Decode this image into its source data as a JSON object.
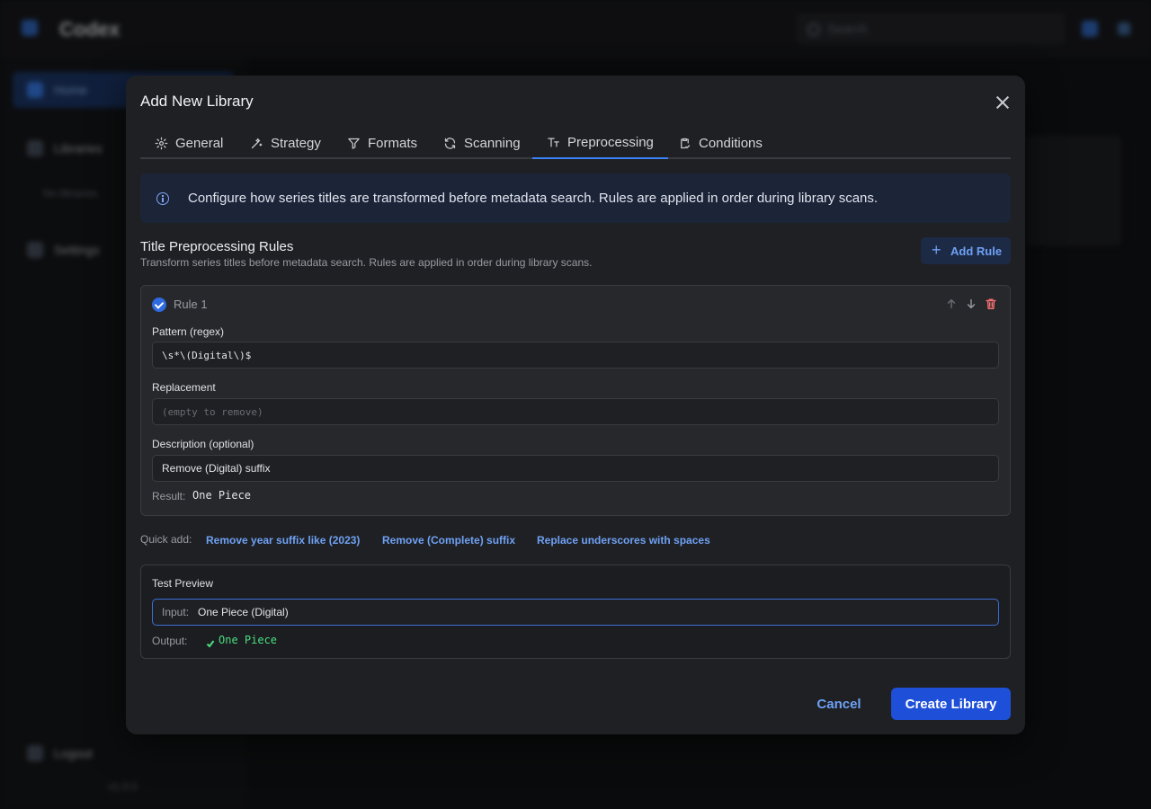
{
  "background": {
    "brand": "Codex",
    "search_placeholder": "Search",
    "nav": [
      "Home",
      "Libraries",
      "Settings",
      "Logout"
    ],
    "sub_text": "No libraries",
    "version": "v1.0.0"
  },
  "modal": {
    "title": "Add New Library",
    "tabs": [
      {
        "label": "General",
        "icon": "gear-icon"
      },
      {
        "label": "Strategy",
        "icon": "wand-icon"
      },
      {
        "label": "Formats",
        "icon": "filter-icon"
      },
      {
        "label": "Scanning",
        "icon": "refresh-icon"
      },
      {
        "label": "Preprocessing",
        "icon": "text-size-icon",
        "active": true
      },
      {
        "label": "Conditions",
        "icon": "clipboard-check-icon"
      }
    ],
    "info": "Configure how series titles are transformed before metadata search. Rules are applied in order during library scans.",
    "section": {
      "title": "Title Preprocessing Rules",
      "description": "Transform series titles before metadata search. Rules are applied in order during library scans.",
      "add_rule": "Add Rule"
    },
    "rule": {
      "label": "Rule 1",
      "pattern_label": "Pattern (regex)",
      "pattern_value": "\\s*\\(Digital\\)$",
      "replacement_label": "Replacement",
      "replacement_value": "",
      "replacement_placeholder": "(empty to remove)",
      "description_label": "Description (optional)",
      "description_value": "Remove (Digital) suffix",
      "result_label": "Result:",
      "result_value": "One Piece"
    },
    "quick_add": {
      "label": "Quick add:",
      "links": [
        "Remove year suffix like (2023)",
        "Remove (Complete) suffix",
        "Replace underscores with spaces"
      ]
    },
    "test": {
      "title": "Test Preview",
      "input_label": "Input:",
      "input_value": "One Piece (Digital)",
      "output_label": "Output:",
      "output_value": "One Piece"
    },
    "buttons": {
      "cancel": "Cancel",
      "create": "Create Library"
    }
  },
  "colors": {
    "accent": "#1e4fd8",
    "link": "#6ea1f5",
    "success": "#4ade80",
    "danger": "#f87171"
  }
}
